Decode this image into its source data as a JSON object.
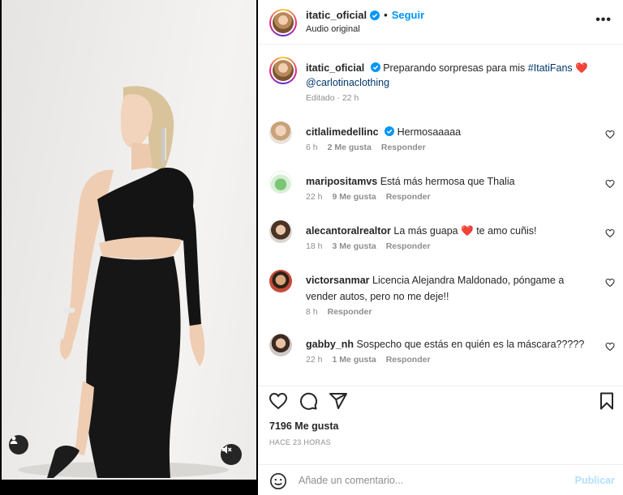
{
  "header": {
    "username": "itatic_oficial",
    "separator": "•",
    "follow_label": "Seguir",
    "audio_label": "Audio original",
    "more_label": "•••"
  },
  "caption": {
    "username": "itatic_oficial",
    "text": "Preparando sorpresas para mis",
    "hashtag": "#ItatiFans",
    "heart": "❤️",
    "mention": "@carlotinaclothing",
    "meta": "Editado · 22 h"
  },
  "comments": [
    {
      "username": "citlalimedellinc",
      "verified": true,
      "text": "Hermosaaaaa",
      "time": "6 h",
      "likes": "2 Me gusta",
      "reply": "Responder"
    },
    {
      "username": "maripositamvs",
      "verified": false,
      "text": "Está más hermosa que Thalia",
      "time": "22 h",
      "likes": "9 Me gusta",
      "reply": "Responder"
    },
    {
      "username": "alecantoralrealtor",
      "verified": false,
      "text_before": "La más guapa",
      "emoji": "❤️",
      "text_after": "te amo cuñis!",
      "time": "18 h",
      "likes": "3 Me gusta",
      "reply": "Responder"
    },
    {
      "username": "victorsanmar",
      "verified": false,
      "text": "Licencia Alejandra Maldonado, póngame a vender autos, pero no me deje!!",
      "time": "8 h",
      "reply": "Responder"
    },
    {
      "username": "gabby_nh",
      "verified": false,
      "text": "Sospecho que estás en quién es la máscara?????",
      "time": "22 h",
      "likes": "1 Me gusta",
      "reply": "Responder"
    }
  ],
  "actions": {
    "likes": "7196 Me gusta",
    "post_time": "HACE 23 HORAS"
  },
  "add_comment": {
    "placeholder": "Añade un comentario...",
    "publish_label": "Publicar"
  },
  "colors": {
    "accent": "#0095f6",
    "publish_disabled": "#b2dffc",
    "secondary_text": "#8e8e8e",
    "heart": "#ed4956"
  },
  "icons": {
    "media_tag": "user-tag-icon",
    "media_mute": "speaker-muted-icon",
    "like": "heart-outline-icon",
    "comment": "comment-bubble-icon",
    "share": "paper-plane-icon",
    "save": "bookmark-icon",
    "emoji": "smiley-icon",
    "verified": "verified-badge-icon"
  }
}
